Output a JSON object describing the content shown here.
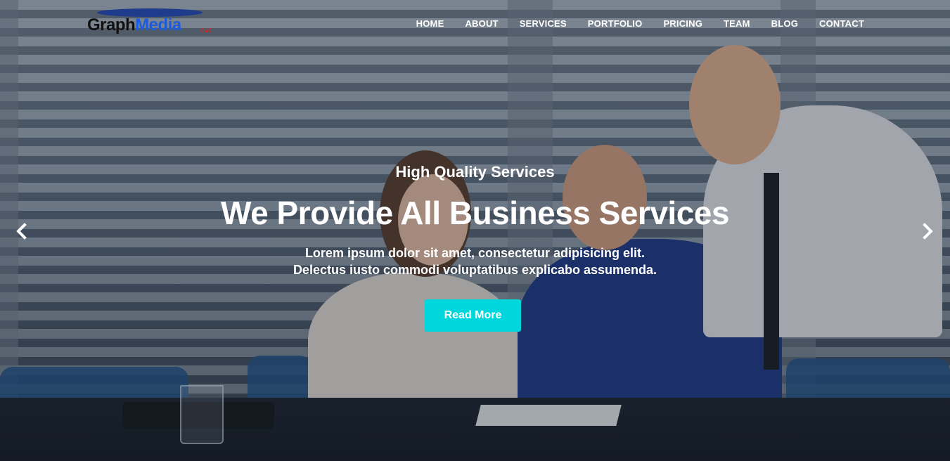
{
  "brand": {
    "logo_word1": "Graph",
    "logo_word2": "Media",
    "logo_suffix": "0w1",
    "colors": {
      "word1": "#111111",
      "word2": "#1c5be0",
      "suffix": "#e02020",
      "swoosh": "#1f3c8c"
    }
  },
  "nav": {
    "items": [
      {
        "label": "HOME"
      },
      {
        "label": "ABOUT"
      },
      {
        "label": "SERVICES"
      },
      {
        "label": "PORTFOLIO"
      },
      {
        "label": "PRICING"
      },
      {
        "label": "TEAM"
      },
      {
        "label": "BLOG"
      },
      {
        "label": "CONTACT"
      }
    ]
  },
  "slide": {
    "subtitle": "High Quality Services",
    "title": "We Provide All Business Services",
    "desc_line1": "Lorem ipsum dolor sit amet, consectetur adipisicing elit.",
    "desc_line2": "Delectus iusto commodi voluptatibus explicabo assumenda.",
    "button_label": "Read More",
    "button_color": "#00d7dc"
  },
  "carousel": {
    "prev_icon": "chevron-left-icon",
    "next_icon": "chevron-right-icon"
  }
}
